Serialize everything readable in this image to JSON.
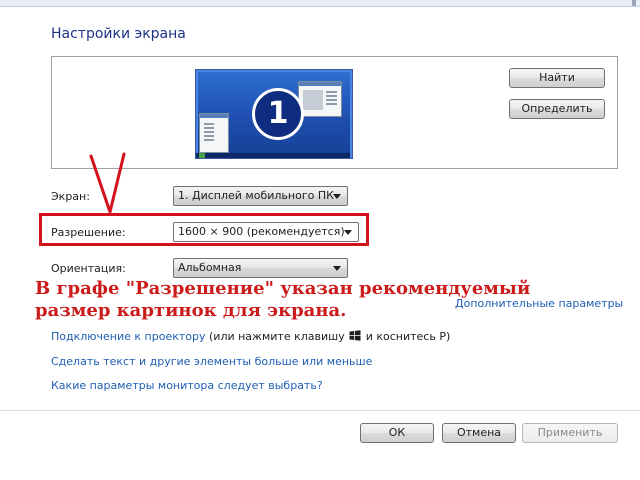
{
  "title": "Настройки экрана",
  "buttons": {
    "find": "Найти",
    "identify": "Определить",
    "ok": "ОК",
    "cancel": "Отмена",
    "apply": "Применить"
  },
  "preview": {
    "monitor_number": "1"
  },
  "fields": {
    "display_label": "Экран:",
    "display_value": "1. Дисплей мобильного ПК",
    "resolution_label": "Разрешение:",
    "resolution_value": "1600 × 900 (рекомендуется)",
    "orientation_label": "Ориентация:",
    "orientation_value": "Альбомная"
  },
  "annotation": {
    "line1": "В графе \"Разрешение\" указан рекомендуемый",
    "line2": "размер картинок для экрана.",
    "color": "#cc1b1b"
  },
  "links": {
    "advanced": "Дополнительные параметры",
    "projector_link": "Подключение к проектору",
    "projector_suffix_a": "(или нажмите клавишу",
    "projector_suffix_b": "и коснитесь P)",
    "text_size": "Сделать текст и другие элементы больше или меньше",
    "monitor_params": "Какие параметры монитора следует выбрать?"
  },
  "colors": {
    "title": "#1e3287",
    "link": "#1f5fb4",
    "highlight_box": "#d3121e"
  },
  "icons": [
    "windows-logo-icon",
    "chevron-down-icon",
    "checkmark-icon"
  ]
}
